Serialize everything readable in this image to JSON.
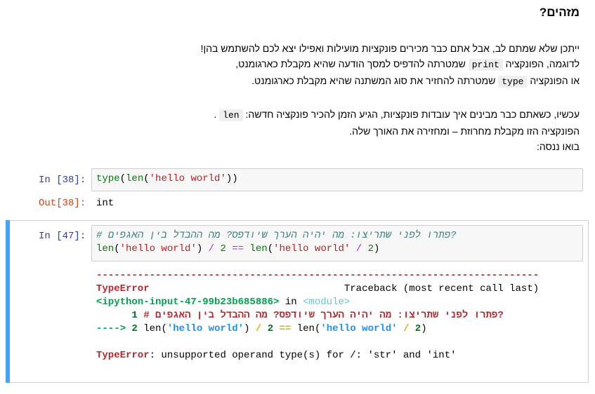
{
  "markdown": {
    "heading": "מזהים?",
    "p1_line1": "ייתכן שלא שמתם לב, אבל אתם כבר מכירים פונקציות מועילות ואפילו יצא לכם להשתמש בהן!",
    "p1_line2_pre": "לדוגמה, הפונקציה",
    "p1_line2_code": "print",
    "p1_line2_post": "שמטרתה להדפיס למסך הודעה שהיא מקבלת כארגומנט,",
    "p1_line3_pre": "או הפונקציה",
    "p1_line3_code": "type",
    "p1_line3_post": "שמטרתה להחזיר את סוג המשתנה שהיא מקבלת כארגומנט.",
    "p2_line1_pre": "עכשיו, כשאתם כבר מבינים איך עובדות פונקציות, הגיע הזמן להכיר פונקציה חדשה:",
    "p2_line1_code": "len",
    "p2_line1_post": ".",
    "p2_line2": "הפונקציה הזו מקבלת מחרוזת – ומחזירה את האורך שלה.",
    "p2_line3": "בואו ננסה:"
  },
  "cell38": {
    "in_prompt": "In [38]:",
    "out_prompt": "Out[38]:",
    "code_fn1": "type",
    "code_p1": "(",
    "code_fn2": "len",
    "code_p2": "(",
    "code_str": "'hello world'",
    "code_p3": "))",
    "output": "int"
  },
  "cell47": {
    "in_prompt": "In [47]:",
    "comment": "# פתרו לפני שתריצו: מה יהיה הערך שיודפס? מה ההבדל בין האגפים?",
    "l2_fn1": "len",
    "l2_p1": "(",
    "l2_s1": "'hello world'",
    "l2_p2": ")",
    "l2_op1": "/",
    "l2_n1": "2",
    "l2_op2": "==",
    "l2_fn2": "len",
    "l2_p3": "(",
    "l2_s2": "'hello world'",
    "l2_op3": "/",
    "l2_n2": "2",
    "l2_p4": ")",
    "tb_dashes": "---------------------------------------------------------------------------",
    "tb_err": "TypeError",
    "tb_head": "Traceback (most recent call last)",
    "tb_input": "<ipython-input-47-99b23b685886>",
    "tb_in": "in",
    "tb_module": "<module>",
    "tb_l1_num": "1",
    "tb_l1_comment": "# פתרו לפני שתריצו: מה יהיה הערך שיודפס? מה ההבדל בין האגפים?",
    "tb_arrow": "---->",
    "tb_l2_num": "2",
    "tb_l2_fn1": "len",
    "tb_l2_p1": "(",
    "tb_l2_s1": "'hello world'",
    "tb_l2_p2": ")",
    "tb_l2_op1": "/",
    "tb_l2_n1": "2",
    "tb_l2_op2": "==",
    "tb_l2_fn2": "len",
    "tb_l2_p3": "(",
    "tb_l2_s2": "'hello world'",
    "tb_l2_op3": "/",
    "tb_l2_n2": "2",
    "tb_l2_p4": ")",
    "tb_final_err": "TypeError",
    "tb_final_msg": ": unsupported operand type(s) for /: 'str' and 'int'"
  },
  "colors": {
    "selection_bar": "#42a5f5",
    "in_prompt": "#303f9f",
    "out_prompt": "#d84315"
  }
}
